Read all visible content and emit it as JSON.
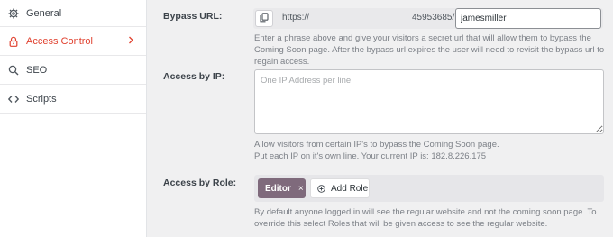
{
  "sidebar": {
    "items": [
      {
        "label": "General",
        "icon": "gear-icon"
      },
      {
        "label": "Access Control",
        "icon": "lock-icon",
        "active": true
      },
      {
        "label": "SEO",
        "icon": "search-icon"
      },
      {
        "label": "Scripts",
        "icon": "code-icon"
      }
    ]
  },
  "bypass": {
    "label": "Bypass URL:",
    "prefix": "https://",
    "code": "45953685/",
    "value": "jamesmiller",
    "help": "Enter a phrase above and give your visitors a secret url that will allow them to bypass the Coming Soon page. After the bypass url expires the user will need to revisit the bypass url to regain access."
  },
  "ip": {
    "label": "Access by IP:",
    "placeholder": "One IP Address per line",
    "help_line1": "Allow visitors from certain IP's to bypass the Coming Soon page.",
    "help_line2": "Put each IP on it's own line. Your current IP is: 182.8.226.175"
  },
  "role": {
    "label": "Access by Role:",
    "tag": "Editor",
    "tag_remove": "×",
    "add_label": "Add Role",
    "help": "By default anyone logged in will see the regular website and not the coming soon page. To override this select Roles that will be given access to see the regular website."
  },
  "colors": {
    "accent": "#e0412f",
    "tag_bg": "#7f6a7c"
  }
}
